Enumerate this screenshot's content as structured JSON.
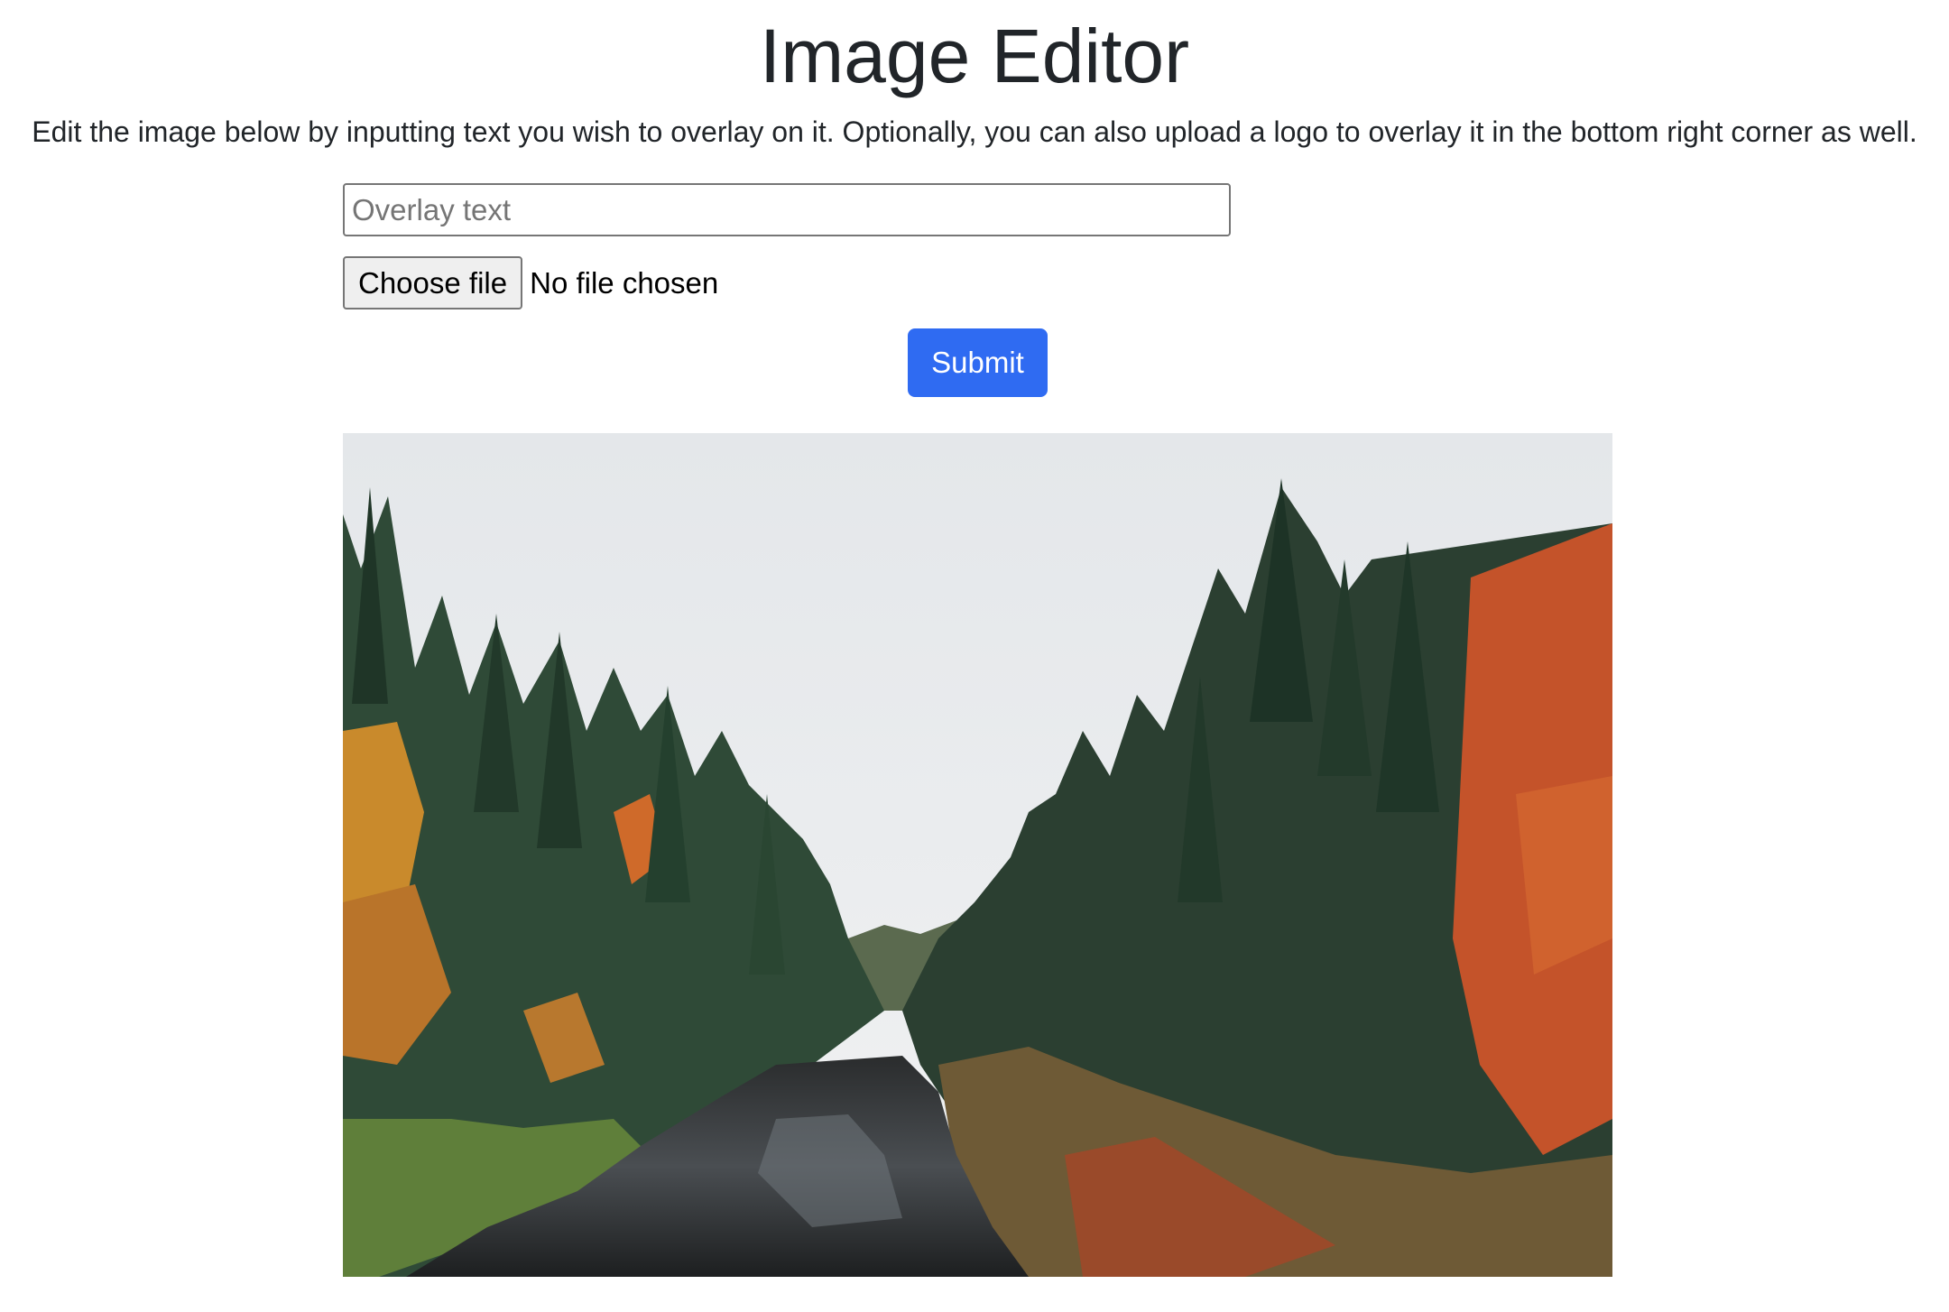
{
  "page": {
    "title": "Image Editor",
    "description": "Edit the image below by inputting text you wish to overlay on it. Optionally, you can also upload a logo to overlay it in the bottom right corner as well."
  },
  "form": {
    "overlay_text": {
      "value": "",
      "placeholder": "Overlay text"
    },
    "file_input": {
      "button_label": "Choose file",
      "status": "No file chosen"
    },
    "submit_label": "Submit"
  },
  "preview": {
    "subject": "forest-river-landscape"
  },
  "colors": {
    "primary": "#2f6bf2",
    "text": "#212529"
  }
}
